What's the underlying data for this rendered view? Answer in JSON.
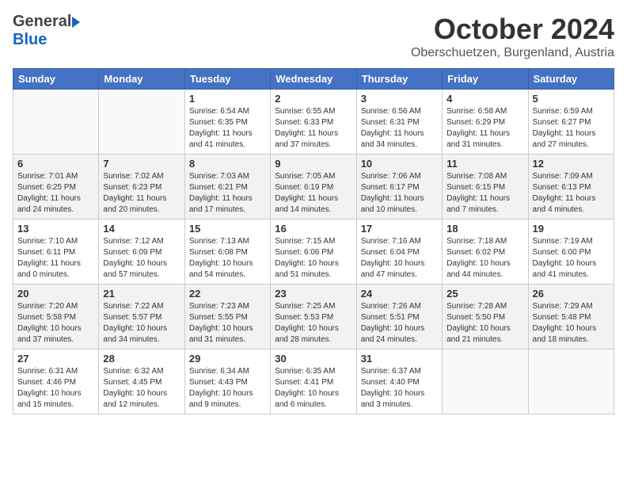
{
  "header": {
    "logo_general": "General",
    "logo_blue": "Blue",
    "month": "October 2024",
    "location": "Oberschuetzen, Burgenland, Austria"
  },
  "days_of_week": [
    "Sunday",
    "Monday",
    "Tuesday",
    "Wednesday",
    "Thursday",
    "Friday",
    "Saturday"
  ],
  "weeks": [
    [
      {
        "day": "",
        "sunrise": "",
        "sunset": "",
        "daylight": ""
      },
      {
        "day": "",
        "sunrise": "",
        "sunset": "",
        "daylight": ""
      },
      {
        "day": "1",
        "sunrise": "Sunrise: 6:54 AM",
        "sunset": "Sunset: 6:35 PM",
        "daylight": "Daylight: 11 hours and 41 minutes."
      },
      {
        "day": "2",
        "sunrise": "Sunrise: 6:55 AM",
        "sunset": "Sunset: 6:33 PM",
        "daylight": "Daylight: 11 hours and 37 minutes."
      },
      {
        "day": "3",
        "sunrise": "Sunrise: 6:56 AM",
        "sunset": "Sunset: 6:31 PM",
        "daylight": "Daylight: 11 hours and 34 minutes."
      },
      {
        "day": "4",
        "sunrise": "Sunrise: 6:58 AM",
        "sunset": "Sunset: 6:29 PM",
        "daylight": "Daylight: 11 hours and 31 minutes."
      },
      {
        "day": "5",
        "sunrise": "Sunrise: 6:59 AM",
        "sunset": "Sunset: 6:27 PM",
        "daylight": "Daylight: 11 hours and 27 minutes."
      }
    ],
    [
      {
        "day": "6",
        "sunrise": "Sunrise: 7:01 AM",
        "sunset": "Sunset: 6:25 PM",
        "daylight": "Daylight: 11 hours and 24 minutes."
      },
      {
        "day": "7",
        "sunrise": "Sunrise: 7:02 AM",
        "sunset": "Sunset: 6:23 PM",
        "daylight": "Daylight: 11 hours and 20 minutes."
      },
      {
        "day": "8",
        "sunrise": "Sunrise: 7:03 AM",
        "sunset": "Sunset: 6:21 PM",
        "daylight": "Daylight: 11 hours and 17 minutes."
      },
      {
        "day": "9",
        "sunrise": "Sunrise: 7:05 AM",
        "sunset": "Sunset: 6:19 PM",
        "daylight": "Daylight: 11 hours and 14 minutes."
      },
      {
        "day": "10",
        "sunrise": "Sunrise: 7:06 AM",
        "sunset": "Sunset: 6:17 PM",
        "daylight": "Daylight: 11 hours and 10 minutes."
      },
      {
        "day": "11",
        "sunrise": "Sunrise: 7:08 AM",
        "sunset": "Sunset: 6:15 PM",
        "daylight": "Daylight: 11 hours and 7 minutes."
      },
      {
        "day": "12",
        "sunrise": "Sunrise: 7:09 AM",
        "sunset": "Sunset: 6:13 PM",
        "daylight": "Daylight: 11 hours and 4 minutes."
      }
    ],
    [
      {
        "day": "13",
        "sunrise": "Sunrise: 7:10 AM",
        "sunset": "Sunset: 6:11 PM",
        "daylight": "Daylight: 11 hours and 0 minutes."
      },
      {
        "day": "14",
        "sunrise": "Sunrise: 7:12 AM",
        "sunset": "Sunset: 6:09 PM",
        "daylight": "Daylight: 10 hours and 57 minutes."
      },
      {
        "day": "15",
        "sunrise": "Sunrise: 7:13 AM",
        "sunset": "Sunset: 6:08 PM",
        "daylight": "Daylight: 10 hours and 54 minutes."
      },
      {
        "day": "16",
        "sunrise": "Sunrise: 7:15 AM",
        "sunset": "Sunset: 6:06 PM",
        "daylight": "Daylight: 10 hours and 51 minutes."
      },
      {
        "day": "17",
        "sunrise": "Sunrise: 7:16 AM",
        "sunset": "Sunset: 6:04 PM",
        "daylight": "Daylight: 10 hours and 47 minutes."
      },
      {
        "day": "18",
        "sunrise": "Sunrise: 7:18 AM",
        "sunset": "Sunset: 6:02 PM",
        "daylight": "Daylight: 10 hours and 44 minutes."
      },
      {
        "day": "19",
        "sunrise": "Sunrise: 7:19 AM",
        "sunset": "Sunset: 6:00 PM",
        "daylight": "Daylight: 10 hours and 41 minutes."
      }
    ],
    [
      {
        "day": "20",
        "sunrise": "Sunrise: 7:20 AM",
        "sunset": "Sunset: 5:58 PM",
        "daylight": "Daylight: 10 hours and 37 minutes."
      },
      {
        "day": "21",
        "sunrise": "Sunrise: 7:22 AM",
        "sunset": "Sunset: 5:57 PM",
        "daylight": "Daylight: 10 hours and 34 minutes."
      },
      {
        "day": "22",
        "sunrise": "Sunrise: 7:23 AM",
        "sunset": "Sunset: 5:55 PM",
        "daylight": "Daylight: 10 hours and 31 minutes."
      },
      {
        "day": "23",
        "sunrise": "Sunrise: 7:25 AM",
        "sunset": "Sunset: 5:53 PM",
        "daylight": "Daylight: 10 hours and 28 minutes."
      },
      {
        "day": "24",
        "sunrise": "Sunrise: 7:26 AM",
        "sunset": "Sunset: 5:51 PM",
        "daylight": "Daylight: 10 hours and 24 minutes."
      },
      {
        "day": "25",
        "sunrise": "Sunrise: 7:28 AM",
        "sunset": "Sunset: 5:50 PM",
        "daylight": "Daylight: 10 hours and 21 minutes."
      },
      {
        "day": "26",
        "sunrise": "Sunrise: 7:29 AM",
        "sunset": "Sunset: 5:48 PM",
        "daylight": "Daylight: 10 hours and 18 minutes."
      }
    ],
    [
      {
        "day": "27",
        "sunrise": "Sunrise: 6:31 AM",
        "sunset": "Sunset: 4:46 PM",
        "daylight": "Daylight: 10 hours and 15 minutes."
      },
      {
        "day": "28",
        "sunrise": "Sunrise: 6:32 AM",
        "sunset": "Sunset: 4:45 PM",
        "daylight": "Daylight: 10 hours and 12 minutes."
      },
      {
        "day": "29",
        "sunrise": "Sunrise: 6:34 AM",
        "sunset": "Sunset: 4:43 PM",
        "daylight": "Daylight: 10 hours and 9 minutes."
      },
      {
        "day": "30",
        "sunrise": "Sunrise: 6:35 AM",
        "sunset": "Sunset: 4:41 PM",
        "daylight": "Daylight: 10 hours and 6 minutes."
      },
      {
        "day": "31",
        "sunrise": "Sunrise: 6:37 AM",
        "sunset": "Sunset: 4:40 PM",
        "daylight": "Daylight: 10 hours and 3 minutes."
      },
      {
        "day": "",
        "sunrise": "",
        "sunset": "",
        "daylight": ""
      },
      {
        "day": "",
        "sunrise": "",
        "sunset": "",
        "daylight": ""
      }
    ]
  ]
}
